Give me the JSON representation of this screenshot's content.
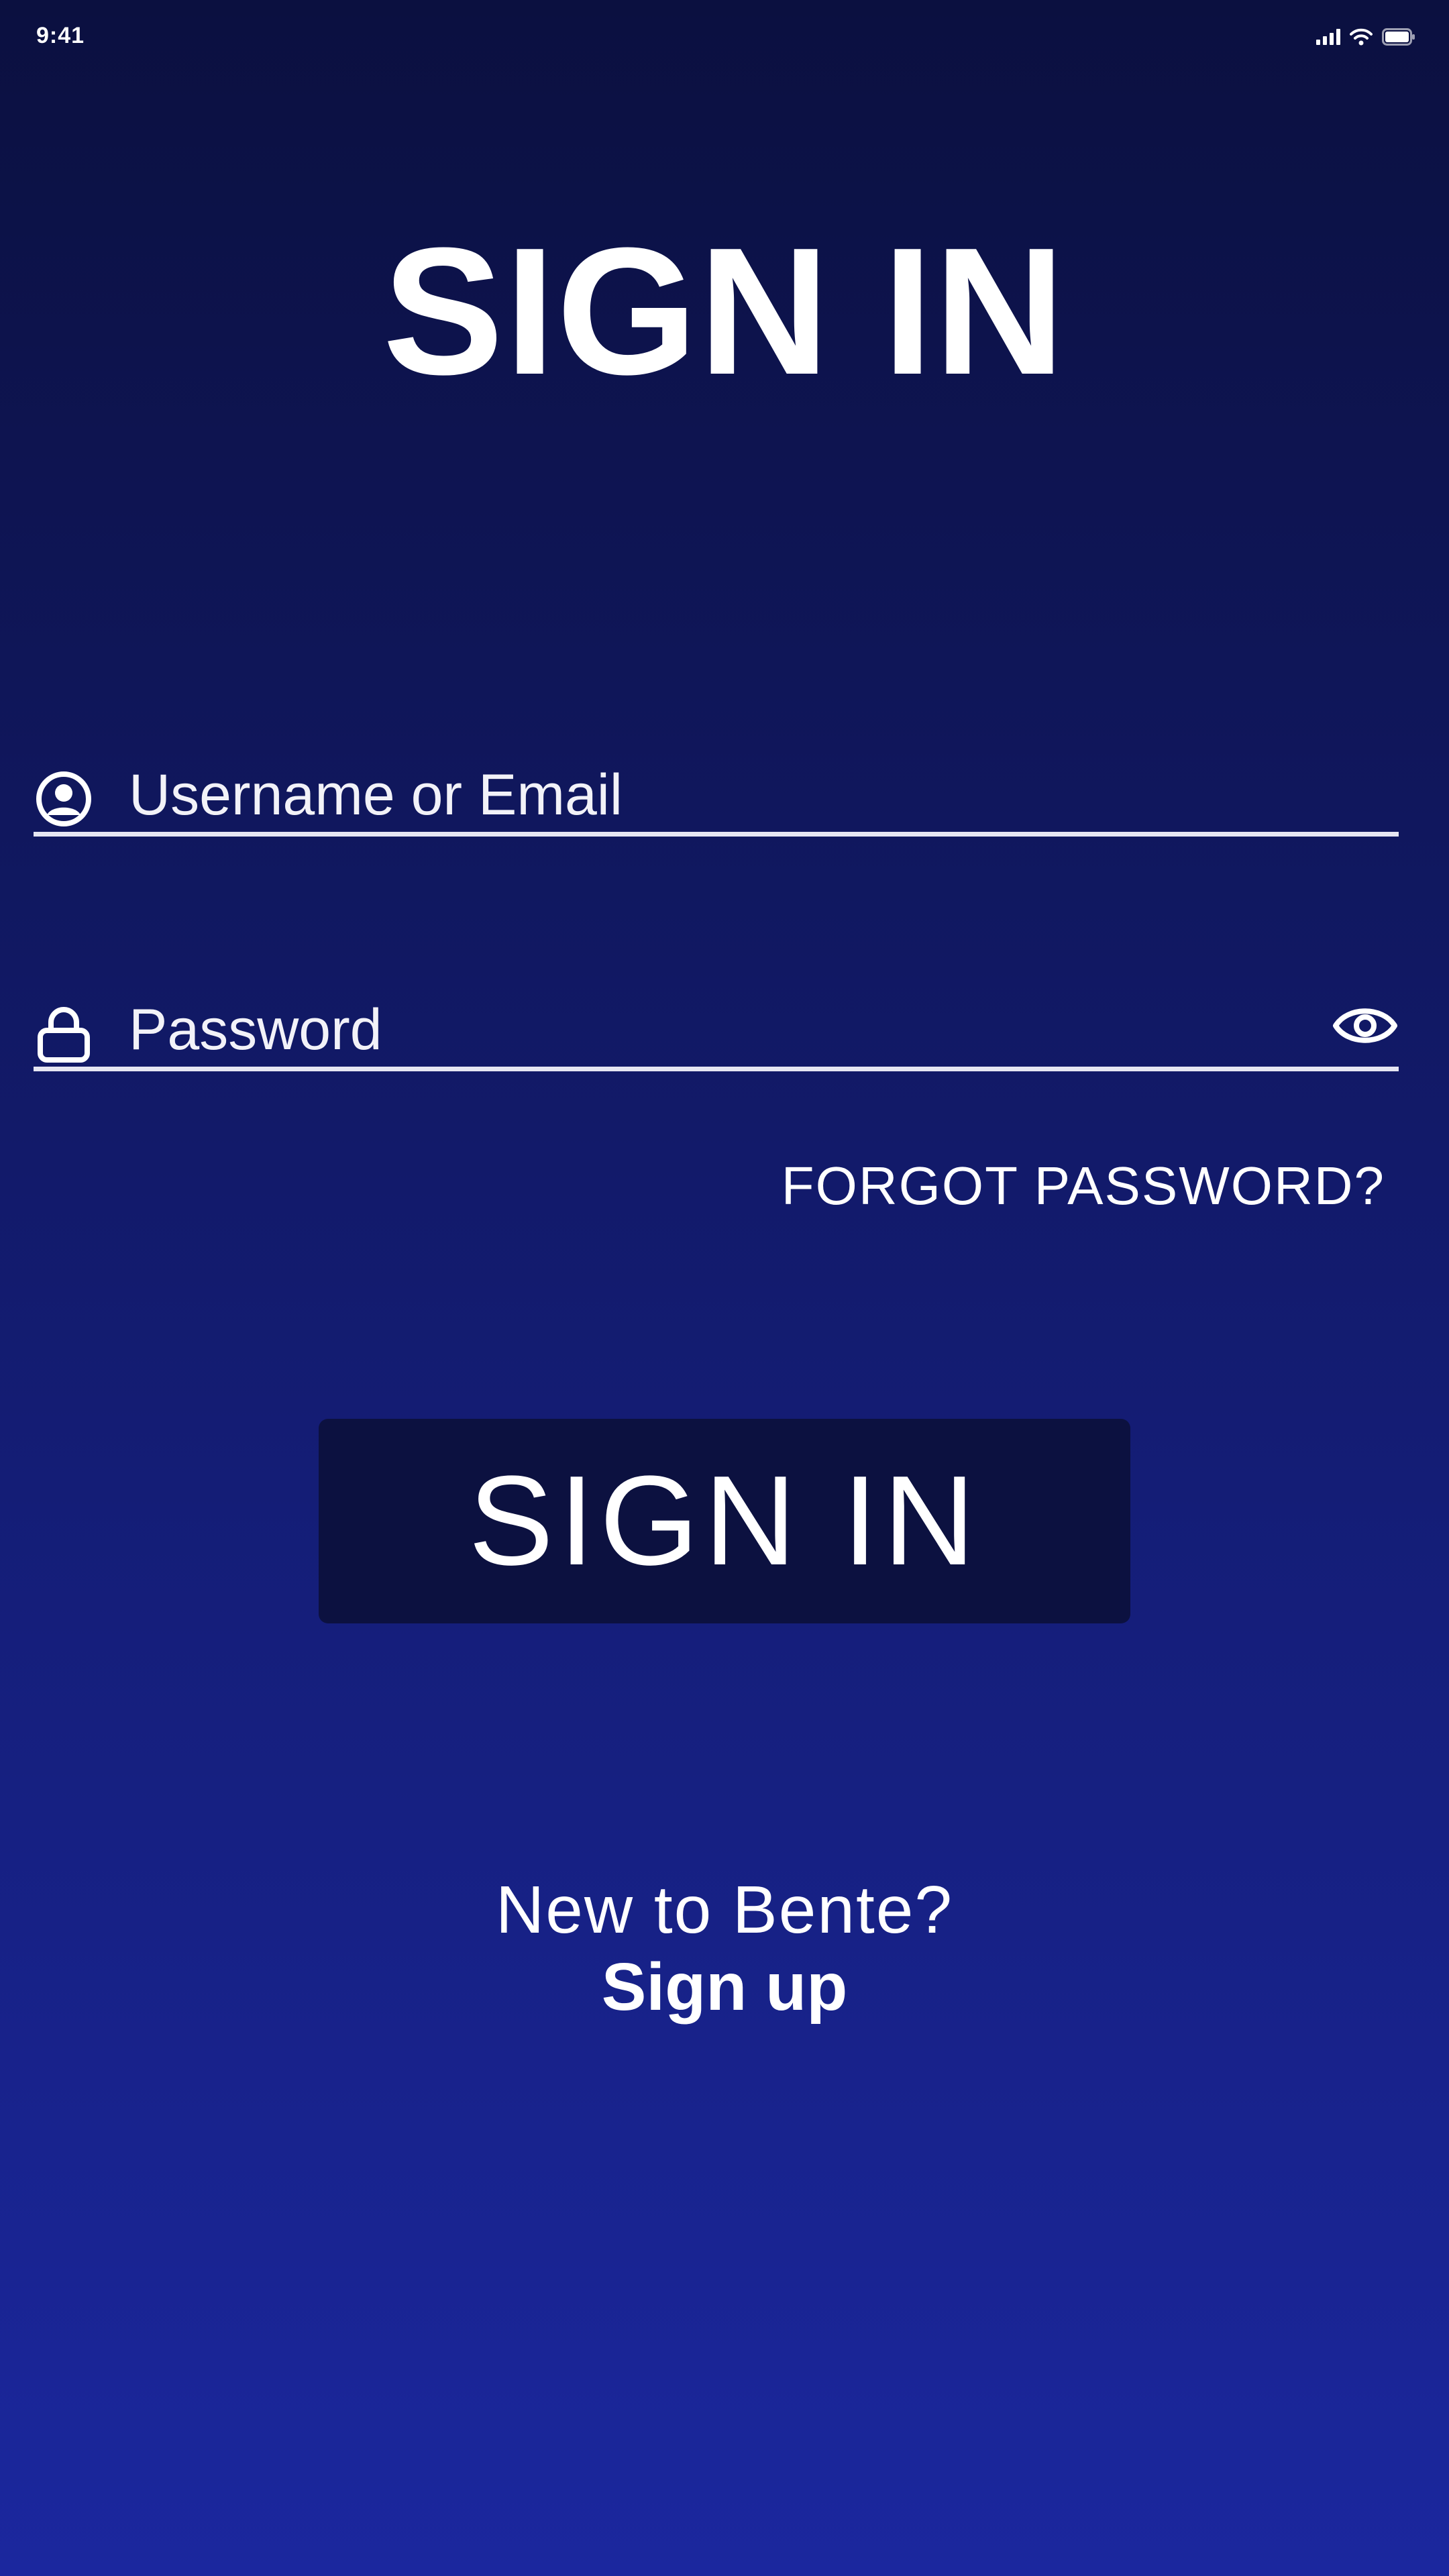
{
  "status_bar": {
    "time": "9:41",
    "icons": [
      "signal-icon",
      "wifi-icon",
      "battery-icon"
    ]
  },
  "title": "SIGN IN",
  "username_field": {
    "icon": "user-circle-icon",
    "placeholder": "Username or Email",
    "value": ""
  },
  "password_field": {
    "icon": "lock-icon",
    "placeholder": "Password",
    "value": "",
    "toggle_icon": "eye-icon"
  },
  "forgot_password": "FORGOT PASSWORD?",
  "sign_in_button": "SIGN IN",
  "signup_prompt": {
    "text": "New to Bente?",
    "link": "Sign up"
  },
  "colors": {
    "background_top": "#0b1040",
    "background_bottom": "#1b279e",
    "button_background": "#0c1140",
    "text": "#ffffff",
    "underline": "#e6e6f2"
  }
}
